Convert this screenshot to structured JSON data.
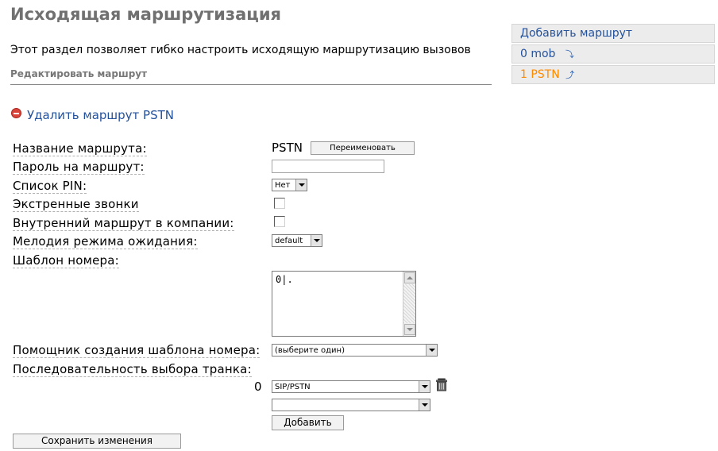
{
  "page": {
    "title": "Исходящая маршрутизация",
    "description": "Этот раздел позволяет гибко настроить исходящую маршрутизацию вызовов",
    "subsection": "Редактировать маршрут"
  },
  "sidebar": {
    "items": [
      {
        "label": "Добавить маршрут",
        "icon": ""
      },
      {
        "label": "0 mob",
        "icon": "arrow-down-icon"
      },
      {
        "label": "1 PSTN",
        "icon": "arrow-up-icon",
        "active": true
      }
    ],
    "active_color": "#ff8a00",
    "link_color": "#24519b"
  },
  "delete_link": {
    "label": "Удалить маршрут PSTN",
    "icon": "minus-circle-icon"
  },
  "form": {
    "route_name": {
      "label": "Название маршрута:",
      "value": "PSTN",
      "button": "Переименовать"
    },
    "route_password": {
      "label": "Пароль на маршрут:",
      "value": ""
    },
    "pin_list": {
      "label": "Список PIN:",
      "selected": "Нет"
    },
    "emergency": {
      "label": "Экстренные звонки",
      "checked": false
    },
    "intra_company": {
      "label": "Внутренний маршрут в компании:",
      "checked": false
    },
    "music_on_hold": {
      "label": "Мелодия режима ожидания:",
      "selected": "default"
    },
    "dial_pattern": {
      "label": "Шаблон номера:",
      "value": "0|."
    },
    "pattern_wizard": {
      "label": "Помощник создания шаблона номера:",
      "selected": "(выберите один)"
    },
    "trunk_sequence": {
      "label": "Последовательность выбора транка:",
      "rows": [
        {
          "index": "0",
          "selected": "SIP/PSTN"
        },
        {
          "index": "",
          "selected": ""
        }
      ],
      "add_button": "Добавить"
    },
    "save_button": "Сохранить изменения"
  }
}
